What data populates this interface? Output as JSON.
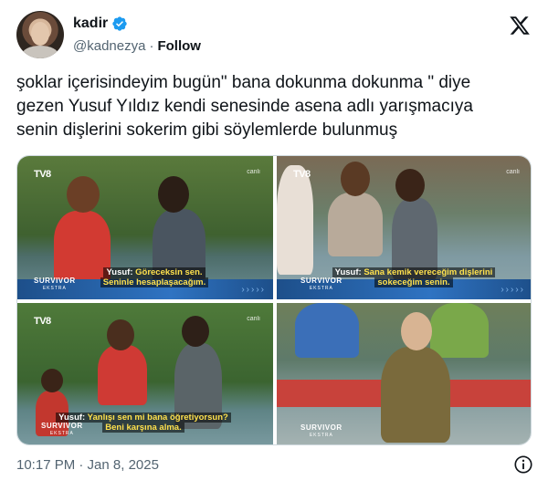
{
  "author": {
    "display_name": "kadir",
    "handle": "@kadnezya",
    "separator": "·",
    "follow_label": "Follow"
  },
  "tweet": {
    "text": "şoklar içerisindeyim bugün\" bana dokunma dokunma \" diye\ngezen Yusuf Yıldız kendi senesinde asena adlı yarışmacıya\nsenin dişlerini sokerim gibi söylemlerde bulunmuş",
    "timestamp": "10:17 PM · Jan 8, 2025"
  },
  "media": {
    "channel_logo": "TV8",
    "live_label": "canlı",
    "show_name": "SURVIVOR",
    "show_sub": "EKSTRA",
    "cells": [
      {
        "speaker": "Yusuf:",
        "line1": "Göreceksin sen.",
        "line2": "Seninle hesaplaşacağım."
      },
      {
        "speaker": "Yusuf:",
        "line1": "Sana kemik vereceğim dişlerini",
        "line2": "sokeceğim senin."
      },
      {
        "speaker": "Yusuf:",
        "line1": "Yanlışı sen mi bana öğretiyorsun?",
        "line2": "Beni karşına alma."
      },
      {
        "speaker": "",
        "line1": "",
        "line2": ""
      }
    ]
  },
  "colors": {
    "text_primary": "#0f1419",
    "text_secondary": "#536471",
    "verified_blue": "#1d9bf0",
    "subtitle_yellow": "#ffe14d",
    "banner_blue": "#2f73c2"
  },
  "icons": {
    "verified": "verified-badge-icon",
    "x_logo": "x-logo-icon",
    "info": "info-icon"
  }
}
